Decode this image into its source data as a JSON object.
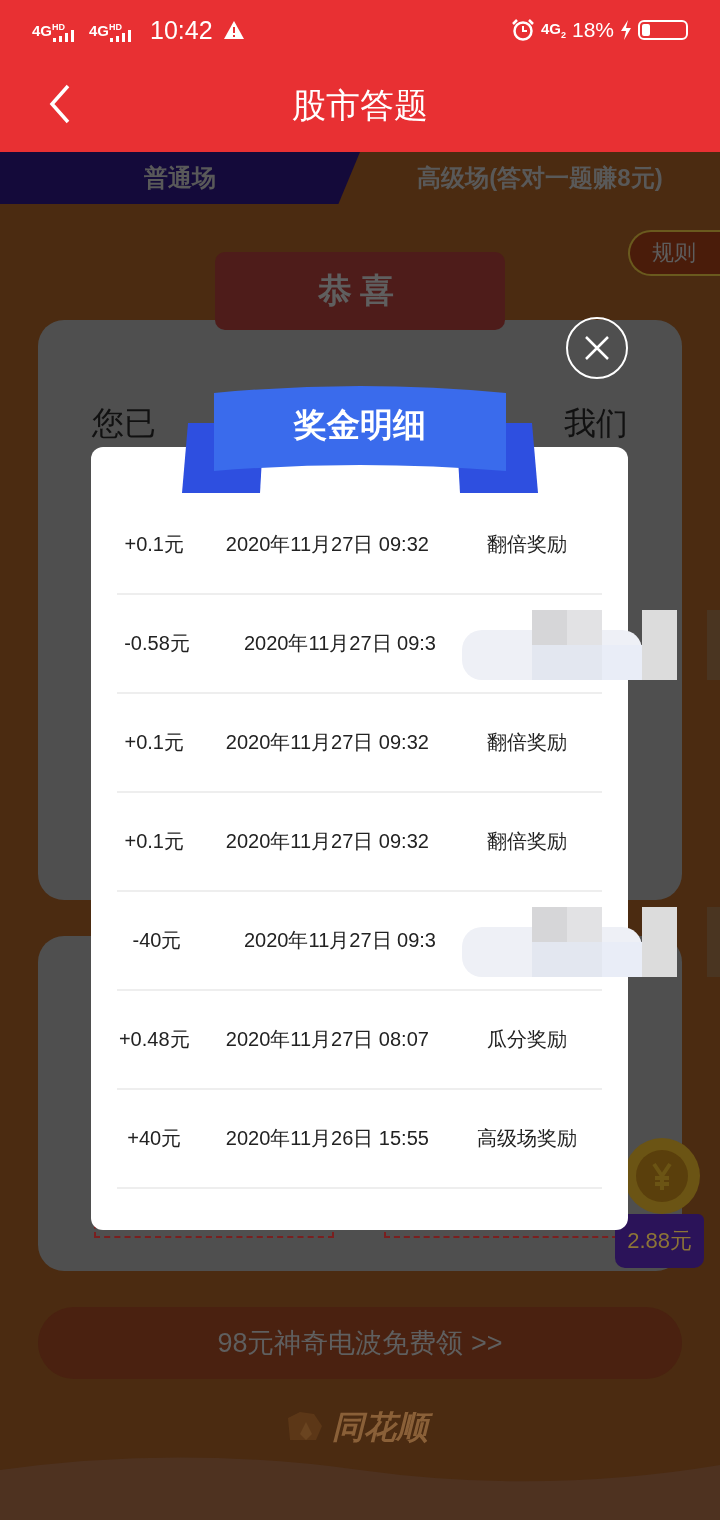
{
  "status_bar": {
    "networks": [
      "4G$^{HD}$",
      "4G$^{HD}$"
    ],
    "time": "10:42",
    "mobile_data": "4G$_{2}$",
    "battery": "18%"
  },
  "nav": {
    "title": "股市答题"
  },
  "tabs": [
    {
      "label": "普通场",
      "selected": true
    },
    {
      "label": "高级场(答对一题赚8元)",
      "selected": false
    }
  ],
  "rules_button": "规则",
  "banner": "恭喜",
  "card_text": [
    "您已",
    "我们"
  ],
  "prize_badge": "2.88元",
  "promo_button": "98元神奇电波免费领 >>",
  "brand": "同花顺",
  "dialog": {
    "title": "奖金明细",
    "rows": [
      {
        "amount": "+0.1元",
        "time": "2020年11月27日 09:32",
        "reason": "翻倍奖励",
        "redacted": false
      },
      {
        "amount": "-0.58元",
        "time": "2020年11月27日 09:3",
        "redacted": true
      },
      {
        "amount": "+0.1元",
        "time": "2020年11月27日 09:32",
        "reason": "翻倍奖励",
        "redacted": false
      },
      {
        "amount": "+0.1元",
        "time": "2020年11月27日 09:32",
        "reason": "翻倍奖励",
        "redacted": false
      },
      {
        "amount": "-40元",
        "time": "2020年11月27日 09:3",
        "redacted": true
      },
      {
        "amount": "+0.48元",
        "time": "2020年11月27日 08:07",
        "reason": "瓜分奖励",
        "redacted": false
      },
      {
        "amount": "+40元",
        "time": "2020年11月26日 15:55",
        "reason": "高级场奖励",
        "redacted": false
      }
    ]
  }
}
